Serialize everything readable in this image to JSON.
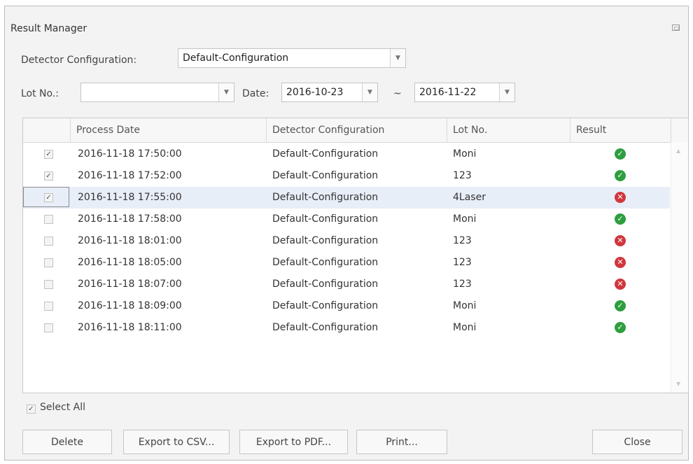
{
  "window": {
    "title": "Result Manager"
  },
  "filters": {
    "detector_label": "Detector Configuration:",
    "detector_value": "Default-Configuration",
    "lot_label": "Lot No.:",
    "lot_value": "",
    "date_label": "Date:",
    "date_from": "2016-10-23",
    "date_sep": "~",
    "date_to": "2016-11-22"
  },
  "table": {
    "columns": [
      "Process Date",
      "Detector Configuration",
      "Lot No.",
      "Result"
    ],
    "rows": [
      {
        "checked": true,
        "date": "2016-11-18 17:50:00",
        "config": "Default-Configuration",
        "lot": "Moni",
        "result": "pass"
      },
      {
        "checked": true,
        "date": "2016-11-18 17:52:00",
        "config": "Default-Configuration",
        "lot": "123",
        "result": "pass"
      },
      {
        "checked": true,
        "date": "2016-11-18 17:55:00",
        "config": "Default-Configuration",
        "lot": "4Laser",
        "result": "fail",
        "selected": true
      },
      {
        "checked": false,
        "date": "2016-11-18 17:58:00",
        "config": "Default-Configuration",
        "lot": "Moni",
        "result": "pass"
      },
      {
        "checked": false,
        "date": "2016-11-18 18:01:00",
        "config": "Default-Configuration",
        "lot": "123",
        "result": "fail"
      },
      {
        "checked": false,
        "date": "2016-11-18 18:05:00",
        "config": "Default-Configuration",
        "lot": "123",
        "result": "fail"
      },
      {
        "checked": false,
        "date": "2016-11-18 18:07:00",
        "config": "Default-Configuration",
        "lot": "123",
        "result": "fail"
      },
      {
        "checked": false,
        "date": "2016-11-18 18:09:00",
        "config": "Default-Configuration",
        "lot": "Moni",
        "result": "pass"
      },
      {
        "checked": false,
        "date": "2016-11-18 18:11:00",
        "config": "Default-Configuration",
        "lot": "Moni",
        "result": "pass"
      }
    ]
  },
  "select_all": {
    "label": "Select All",
    "checked": true
  },
  "buttons": {
    "delete": "Delete",
    "export_csv": "Export to CSV...",
    "export_pdf": "Export to PDF...",
    "print": "Print...",
    "close": "Close"
  },
  "icons": {
    "pass": "check-circle-icon",
    "fail": "x-circle-icon"
  },
  "colors": {
    "pass": "#2e9e3e",
    "fail": "#d0373d",
    "selected_row": "#e8eef8"
  }
}
